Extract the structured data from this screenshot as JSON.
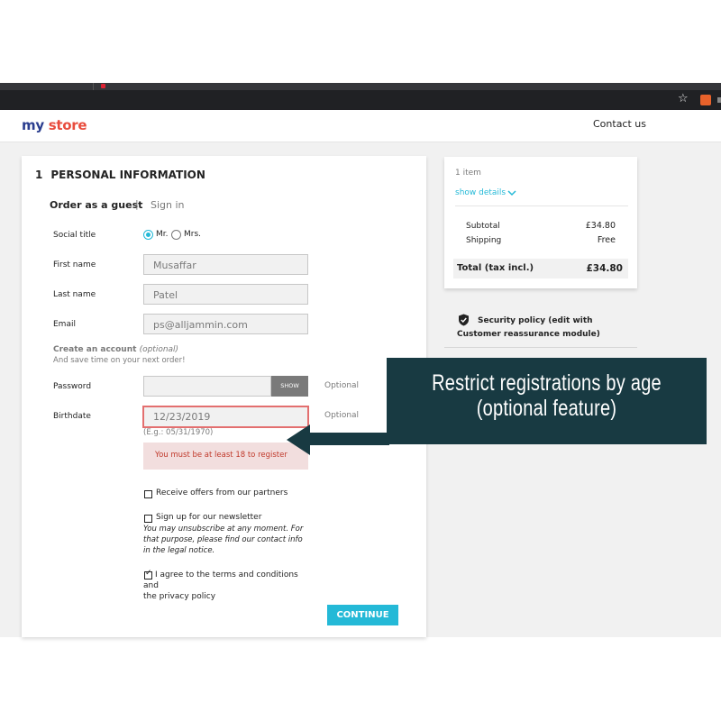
{
  "header": {
    "logo_part1": "my",
    "logo_part2": "store",
    "contact_link": "Contact us"
  },
  "personal_info": {
    "step_number": "1",
    "step_title": "PERSONAL INFORMATION",
    "tab_guest": "Order as a guest",
    "tab_separator": "|",
    "tab_signin": "Sign in",
    "social_title_label": "Social title",
    "social_options": [
      "Mr.",
      "Mrs."
    ],
    "social_selected": "Mr.",
    "first_name_label": "First name",
    "first_name_value": "Musaffar",
    "last_name_label": "Last name",
    "last_name_value": "Patel",
    "email_label": "Email",
    "email_value": "ps@alljammin.com",
    "create_account_title": "Create an account",
    "create_account_optional": "(optional)",
    "create_account_sub": "And save time on your next order!",
    "password_label": "Password",
    "show_button": "SHOW",
    "optional_text": "Optional",
    "birthdate_label": "Birthdate",
    "birthdate_value": "12/23/2019",
    "birthdate_hint": "(E.g.: 05/31/1970)",
    "birthdate_error": "You must be at least 18 to register",
    "offers_label": "Receive offers from our partners",
    "offers_checked": false,
    "newsletter_label": "Sign up for our newsletter",
    "newsletter_checked": false,
    "newsletter_note": "You may unsubscribe at any moment. For that purpose, please find our contact info in the legal notice.",
    "terms_label_line1": "I agree to the terms and conditions and",
    "terms_label_line2": "the privacy policy",
    "terms_checked": true,
    "continue_button": "CONTINUE"
  },
  "summary": {
    "item_count": "1 item",
    "show_details": "show details",
    "subtotal_label": "Subtotal",
    "subtotal_value": "£34.80",
    "shipping_label": "Shipping",
    "shipping_value": "Free",
    "total_label": "Total (tax incl.)",
    "total_value": "£34.80"
  },
  "reassurance": {
    "text": "Security policy (edit with Customer reassurance module)"
  },
  "annotation": {
    "line1": "Restrict registrations by age",
    "line2": "(optional feature)"
  },
  "colors": {
    "accent": "#24b9d7",
    "banner": "#183a42",
    "error_border": "#e36f6f",
    "error_bg": "#f2dede",
    "logo_blue": "#2b3e8f",
    "logo_red": "#e84c3d"
  }
}
